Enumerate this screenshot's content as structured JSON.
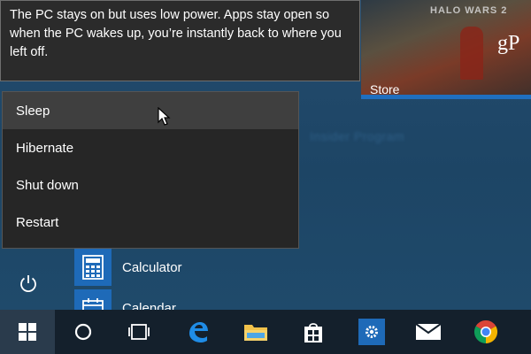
{
  "tooltip": {
    "text": "The PC stays on but uses low power. Apps stay open so when the PC wakes up, you’re instantly back to where you left off."
  },
  "power_menu": {
    "items": [
      {
        "label": "Sleep",
        "selected": true
      },
      {
        "label": "Hibernate",
        "selected": false
      },
      {
        "label": "Shut down",
        "selected": false
      },
      {
        "label": "Restart",
        "selected": false
      }
    ]
  },
  "store_tile": {
    "label": "Store",
    "game_title": "HALO WARS 2",
    "logo": "gP"
  },
  "apps": [
    {
      "name": "Calculator",
      "icon": "calculator-icon"
    },
    {
      "name": "Calendar",
      "icon": "calendar-icon"
    }
  ],
  "taskbar": {
    "items": [
      "windows-logo-icon",
      "cortana-icon",
      "task-view-icon",
      "edge-icon",
      "file-explorer-icon",
      "store-bag-icon",
      "settings-gear-icon",
      "mail-icon",
      "chrome-icon"
    ]
  },
  "colors": {
    "accent": "#1e6ab8",
    "start_background": "#1f4a6b",
    "taskbar": "#14202c",
    "menu_background": "#262626",
    "menu_selected": "#3f3f3f"
  }
}
